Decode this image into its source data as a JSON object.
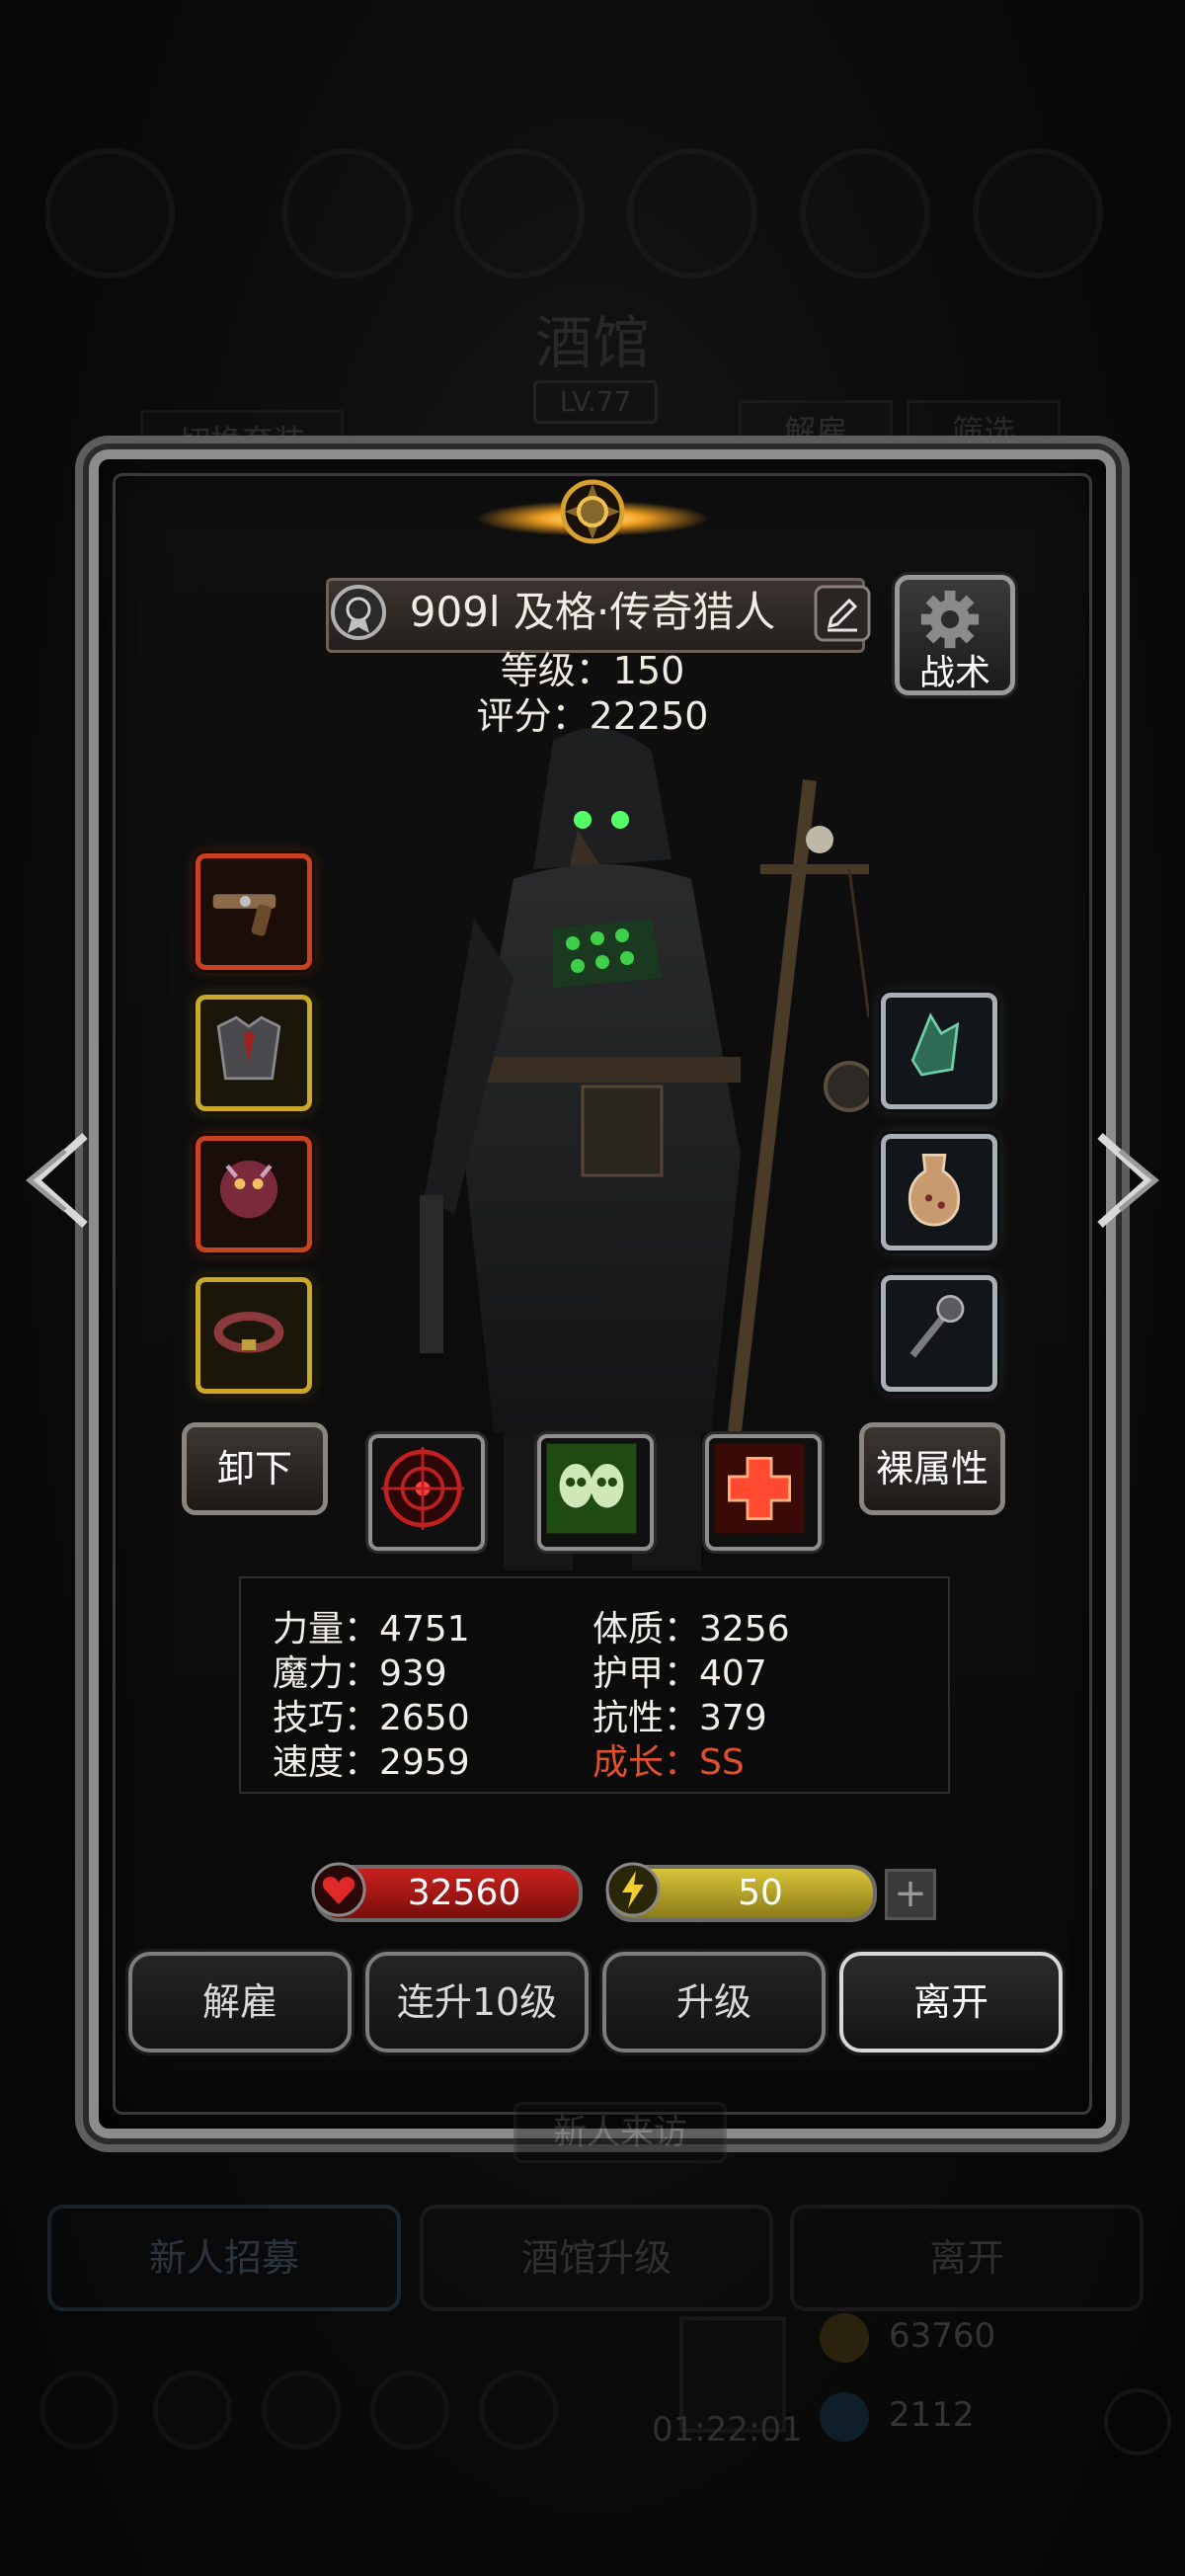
{
  "background": {
    "title": "酒馆",
    "level": "LV.77",
    "switch_outfit": "切换套装",
    "dismiss": "解雇",
    "filter": "筛选",
    "visitor": "新人来访",
    "bottom_buttons": [
      "新人招募",
      "酒馆升级",
      "离开"
    ],
    "gold": "63760",
    "gems": "2112",
    "timer": "01:22:01"
  },
  "hero": {
    "name": "909l 及格·传奇猎人",
    "level_line": "等级：150",
    "score_line": "评分：22250"
  },
  "tactic_label": "战术",
  "unequip_label": "卸下",
  "base_attr_label": "裸属性",
  "equipment_left": [
    {
      "icon": "pistol-icon",
      "rarity": "red"
    },
    {
      "icon": "armor-icon",
      "rarity": "gold"
    },
    {
      "icon": "demon-orb-icon",
      "rarity": "red"
    },
    {
      "icon": "belt-icon",
      "rarity": "gold"
    }
  ],
  "equipment_right": [
    {
      "icon": "crystal-icon",
      "rarity": "silver"
    },
    {
      "icon": "potion-flask-icon",
      "rarity": "silver"
    },
    {
      "icon": "mace-icon",
      "rarity": "silver"
    }
  ],
  "skills": [
    {
      "icon": "target-skill-icon"
    },
    {
      "icon": "skulls-skill-icon"
    },
    {
      "icon": "heal-cross-skill-icon"
    }
  ],
  "stats": {
    "strength": "力量：4751",
    "magic": "魔力：939",
    "skill": "技巧：2650",
    "speed": "速度：2959",
    "constitution": "体质：3256",
    "armor": "护甲：407",
    "resistance": "抗性：379",
    "growth": "成长：SS"
  },
  "hp": {
    "value": "32560",
    "fill": 1.0,
    "color": "#c8211e"
  },
  "energy": {
    "value": "50",
    "fill": 1.0,
    "color": "#d8c43a"
  },
  "actions": {
    "dismiss": "解雇",
    "level_up_10": "连升10级",
    "level_up": "升级",
    "leave": "离开"
  }
}
